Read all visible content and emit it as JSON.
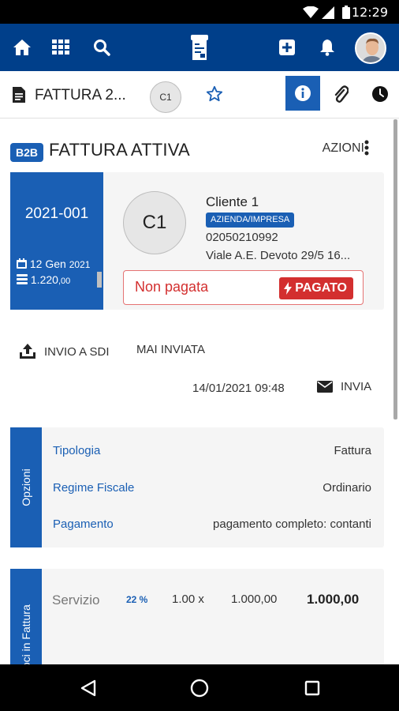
{
  "status_bar": {
    "time": "12:29"
  },
  "topnav": {
    "icons": [
      "home-icon",
      "apps-grid-icon",
      "search-icon",
      "app-logo-icon",
      "add-icon",
      "bell-icon",
      "avatar"
    ]
  },
  "docbar": {
    "title": "FATTURA 2...",
    "avatar_initials": "C1"
  },
  "header": {
    "badge": "B2B",
    "title": "FATTURA ATTIVA",
    "actions_label": "AZIONI"
  },
  "invoice_card": {
    "number": "2021-001",
    "date_day": "12 Gen",
    "date_year": "2021",
    "amount": "1.220",
    "amount_cents": ",00",
    "client_initials": "C1",
    "client_name": "Cliente 1",
    "client_type": "AZIENDA/IMPRESA",
    "vat_number": "02050210992",
    "address": "Viale A.E. Devoto 29/5 16...",
    "payment_status": "Non pagata",
    "paid_button": "PAGATO"
  },
  "sdi": {
    "send_label": "INVIO A SDI",
    "status": "MAI INVIATA",
    "timestamp": "14/01/2021 09:48",
    "send_button": "INVIA"
  },
  "options": {
    "tab_label": "Opzioni",
    "rows": [
      {
        "key": "Tipologia",
        "value": "Fattura"
      },
      {
        "key": "Regime Fiscale",
        "value": "Ordinario"
      },
      {
        "key": "Pagamento",
        "value": "pagamento completo: contanti"
      }
    ]
  },
  "line_items": {
    "tab_label": "Voci in Fattura",
    "items": [
      {
        "name": "Servizio",
        "vat": "22 %",
        "quantity": "1.00 x",
        "unit_price": "1.000,00",
        "total": "1.000,00"
      }
    ]
  },
  "colors": {
    "primary": "#003f8a",
    "accent": "#1a5fb4",
    "danger": "#d32f2f"
  }
}
